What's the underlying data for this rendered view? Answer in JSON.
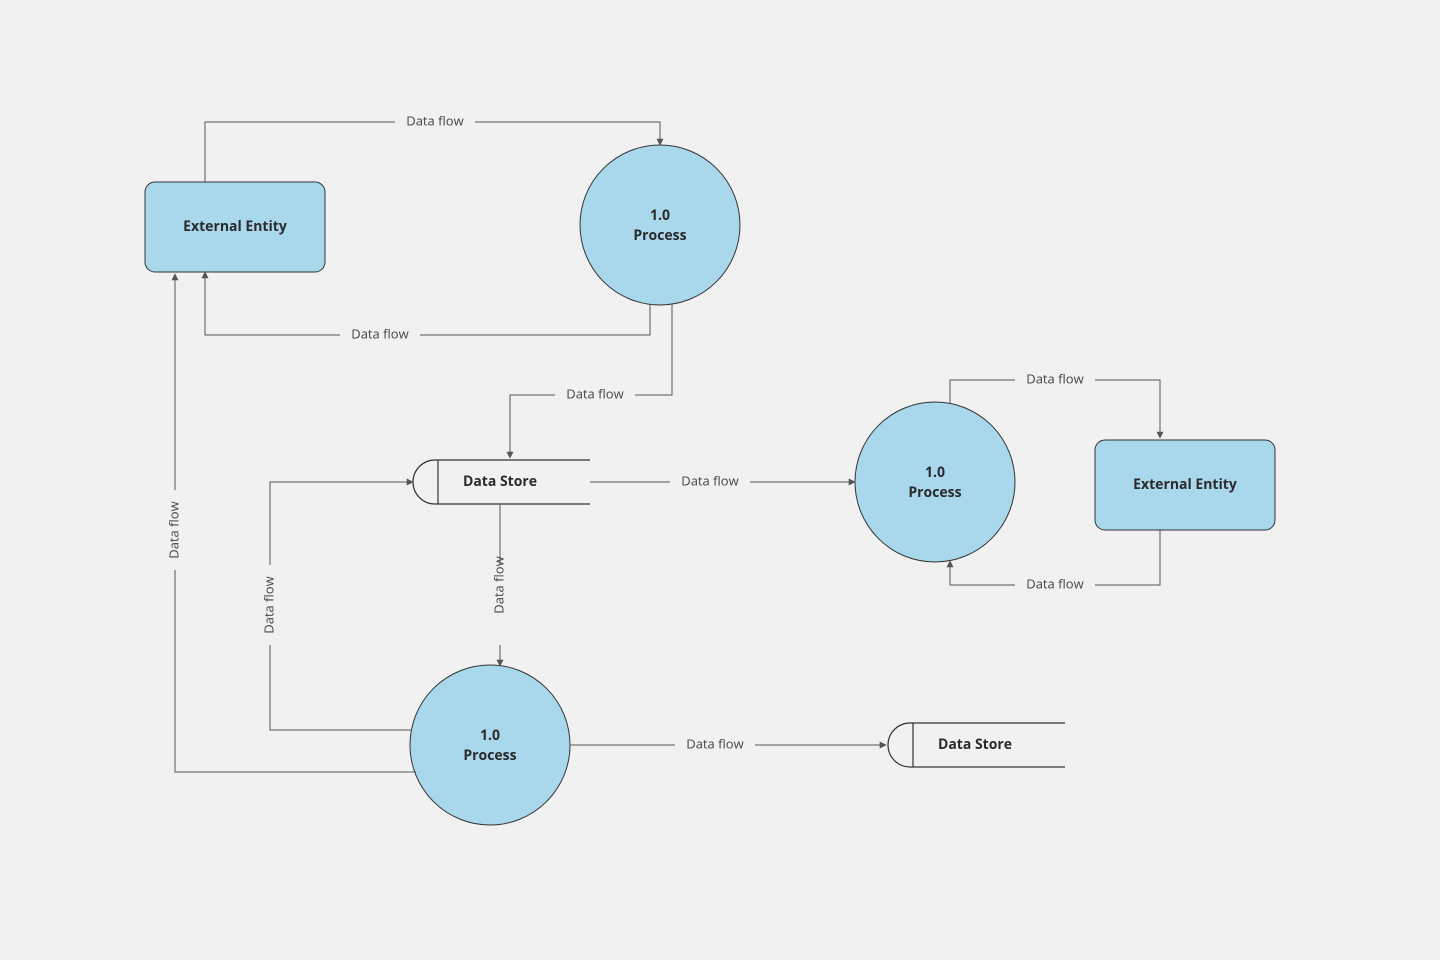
{
  "diagram": {
    "type": "Data Flow Diagram (Gane-Sarson)",
    "nodes": {
      "entity1": {
        "label": "External Entity"
      },
      "entity2": {
        "label": "External Entity"
      },
      "process1": {
        "id": "1.0",
        "name": "Process"
      },
      "process2": {
        "id": "1.0",
        "name": "Process"
      },
      "process3": {
        "id": "1.0",
        "name": "Process"
      },
      "datastore1": {
        "label": "Data Store"
      },
      "datastore2": {
        "label": "Data Store"
      }
    },
    "edges": {
      "e_entity1_to_process1": "Data flow",
      "e_process1_to_entity1": "Data flow",
      "e_process1_to_ds1": "Data flow",
      "e_ds1_to_process2": "Data flow",
      "e_process2_to_entity2": "Data flow",
      "e_entity2_to_process2": "Data flow",
      "e_ds1_to_process3": "Data flow",
      "e_process3_to_ds1": "Data flow",
      "e_process3_to_entity1": "Data flow",
      "e_process3_to_ds2": "Data flow"
    },
    "colors": {
      "node_fill": "#a9d8ec",
      "node_stroke": "#333333",
      "edge_stroke": "#555555",
      "background": "#f1f1f1"
    }
  }
}
